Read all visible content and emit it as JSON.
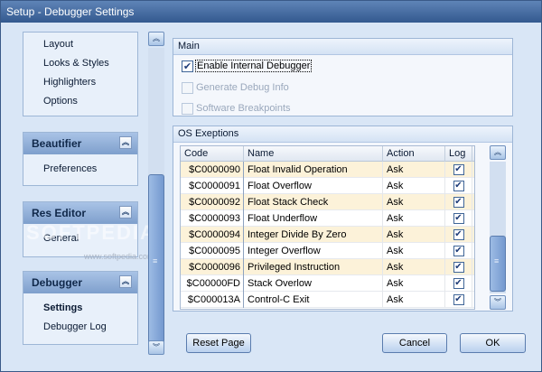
{
  "window": {
    "title": "Setup - Debugger Settings"
  },
  "nav": {
    "general": {
      "items": [
        "Layout",
        "Looks & Styles",
        "Highlighters",
        "Options"
      ]
    },
    "beautifier": {
      "title": "Beautifier",
      "items": [
        "Preferences"
      ]
    },
    "res_editor": {
      "title": "Res Editor",
      "items": [
        "General"
      ]
    },
    "debugger": {
      "title": "Debugger",
      "items": [
        "Settings",
        "Debugger Log"
      ],
      "active": "Settings"
    }
  },
  "main": {
    "title": "Main",
    "enable_internal_debugger": {
      "label": "Enable Internal Debugger",
      "checked": true
    },
    "generate_debug_info": {
      "label": "Generate Debug Info",
      "checked": false,
      "enabled": false
    },
    "software_breakpoints": {
      "label": "Software Breakpoints",
      "checked": false,
      "enabled": false
    }
  },
  "os_exceptions": {
    "title": "OS Exeptions",
    "columns": [
      "Code",
      "Name",
      "Action",
      "Log"
    ],
    "rows": [
      {
        "code": "$C0000090",
        "name": "Float Invalid Operation",
        "action": "Ask",
        "log": true
      },
      {
        "code": "$C0000091",
        "name": "Float Overflow",
        "action": "Ask",
        "log": true
      },
      {
        "code": "$C0000092",
        "name": "Float Stack Check",
        "action": "Ask",
        "log": true
      },
      {
        "code": "$C0000093",
        "name": "Float Underflow",
        "action": "Ask",
        "log": true
      },
      {
        "code": "$C0000094",
        "name": "Integer Divide By Zero",
        "action": "Ask",
        "log": true
      },
      {
        "code": "$C0000095",
        "name": "Integer Overflow",
        "action": "Ask",
        "log": true
      },
      {
        "code": "$C0000096",
        "name": "Privileged Instruction",
        "action": "Ask",
        "log": true
      },
      {
        "code": "$C00000FD",
        "name": "Stack Overlow",
        "action": "Ask",
        "log": true
      },
      {
        "code": "$C000013A",
        "name": "Control-C Exit",
        "action": "Ask",
        "log": true
      }
    ]
  },
  "buttons": {
    "reset_page": "Reset Page",
    "cancel": "Cancel",
    "ok": "OK"
  },
  "watermark": {
    "brand": "SOFTPEDIA",
    "url": "www.softpedia.com"
  },
  "colors": {
    "title_bar": "#33598f",
    "background": "#d9e6f6",
    "row_alt": "#fcf2d9",
    "accent": "#7499cf"
  }
}
